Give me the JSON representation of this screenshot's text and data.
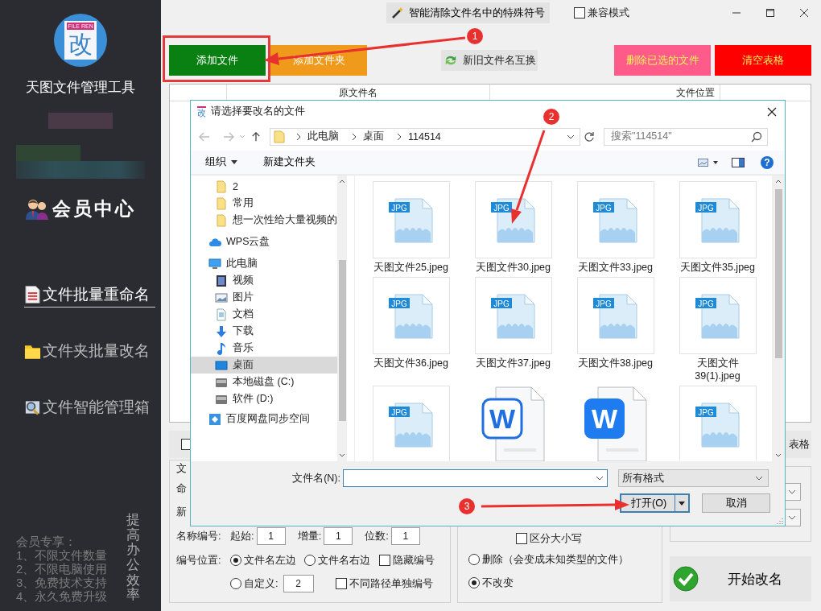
{
  "sidebar": {
    "logo": {
      "tag": "FILE REN",
      "glyph": "改"
    },
    "app_name": "天图文件管理工具",
    "member_center": "会员中心",
    "nav": [
      {
        "label": "文件批量重命名",
        "kind": "list",
        "selected": true
      },
      {
        "label": "文件夹批量改名",
        "kind": "folder",
        "selected": false
      },
      {
        "label": "文件智能管理箱",
        "kind": "search",
        "selected": false
      }
    ],
    "perks": [
      "会员专享：",
      "1、不限文件数量",
      "2、不限电脑使用",
      "3、免费技术支持",
      "4、永久免费升级"
    ],
    "slogan": "提高办公效率"
  },
  "top_bar": {
    "clean_button": "智能清除文件名中的特殊符号",
    "compat": {
      "label": "兼容模式",
      "checked": false
    }
  },
  "toolbar": [
    {
      "label": "添加文件",
      "kind": "green",
      "highlighted": true
    },
    {
      "label": "添加文件夹",
      "kind": "orange",
      "highlighted": false
    },
    {
      "label": "新旧文件名互换",
      "kind": "swap",
      "highlighted": false
    },
    {
      "label": "删除已选的文件",
      "kind": "pink",
      "highlighted": false
    },
    {
      "label": "清空表格",
      "kind": "red",
      "highlighted": false
    }
  ],
  "table": {
    "columns": [
      "原文件名",
      "文件位置"
    ]
  },
  "table_footer": {
    "select_all_checked": false,
    "right_label": "表格"
  },
  "rename_group": {
    "title": "文",
    "rows": [
      "命",
      "新"
    ],
    "numbering": {
      "label": "名称编号:",
      "fields": [
        {
          "label": "起始:",
          "value": "1"
        },
        {
          "label": "增量:",
          "value": "1"
        },
        {
          "label": "位数:",
          "value": "1"
        }
      ]
    },
    "position": {
      "label": "编号位置:",
      "left": {
        "label": "文件名左边",
        "selected": true
      },
      "right": {
        "label": "文件名右边",
        "selected": false
      },
      "custom": {
        "label": "自定义:",
        "selected": false,
        "value": "2"
      },
      "hide": {
        "label": "隐藏编号",
        "checked": false
      },
      "separate": {
        "label": "不同路径单独编号",
        "checked": false
      }
    }
  },
  "extension_group": {
    "case": {
      "label": "区分大小写",
      "checked": false
    },
    "options": [
      {
        "label": "删除（会变成未知类型的文件）",
        "selected": false
      },
      {
        "label": "不改变",
        "selected": true
      }
    ]
  },
  "start_button": "开始改名",
  "dialog": {
    "icon_glyph": "改",
    "title": "请选择要改名的文件",
    "path": [
      "此电脑",
      "桌面",
      "114514"
    ],
    "search_placeholder": "搜索\"114514\"",
    "organize": "组织",
    "new_folder": "新建文件夹",
    "help": "?",
    "tree": [
      {
        "label": "2",
        "kind": "folder",
        "selected": false
      },
      {
        "label": "常用",
        "kind": "folder",
        "selected": false
      },
      {
        "label": "想一次性给大量视频的",
        "kind": "folder",
        "selected": false
      },
      {
        "label": "WPS云盘",
        "kind": "cloud",
        "selected": false
      },
      {
        "label": "此电脑",
        "kind": "computer",
        "selected": false,
        "children": [
          {
            "label": "视频",
            "kind": "video",
            "selected": false
          },
          {
            "label": "图片",
            "kind": "picture",
            "selected": false
          },
          {
            "label": "文档",
            "kind": "document",
            "selected": false
          },
          {
            "label": "下载",
            "kind": "download",
            "selected": false
          },
          {
            "label": "音乐",
            "kind": "music",
            "selected": false
          },
          {
            "label": "桌面",
            "kind": "desktop",
            "selected": true
          },
          {
            "label": "本地磁盘 (C:)",
            "kind": "drive",
            "selected": false
          },
          {
            "label": "软件 (D:)",
            "kind": "drive",
            "selected": false
          }
        ]
      },
      {
        "label": "百度网盘同步空间",
        "kind": "sync",
        "selected": false
      }
    ],
    "files": [
      {
        "name": "天图文件25.jpeg",
        "kind": "jpg",
        "tag": "JPG"
      },
      {
        "name": "天图文件30.jpeg",
        "kind": "jpg",
        "tag": "JPG"
      },
      {
        "name": "天图文件33.jpeg",
        "kind": "jpg",
        "tag": "JPG"
      },
      {
        "name": "天图文件35.jpeg",
        "kind": "jpg",
        "tag": "JPG"
      },
      {
        "name": "天图文件36.jpeg",
        "kind": "jpg",
        "tag": "JPG"
      },
      {
        "name": "天图文件37.jpeg",
        "kind": "jpg",
        "tag": "JPG"
      },
      {
        "name": "天图文件38.jpeg",
        "kind": "jpg",
        "tag": "JPG"
      },
      {
        "name": "天图文件39(1).jpeg",
        "kind": "jpg",
        "tag": "JPG"
      },
      {
        "kind": "jpg",
        "tag": "JPG"
      },
      {
        "kind": "wps-outline",
        "tag": "W"
      },
      {
        "kind": "wps-filled",
        "tag": "W"
      },
      {
        "kind": "jpg",
        "tag": "JPG"
      }
    ],
    "filename_label": "文件名(N):",
    "filetype": "所有格式",
    "open": "打开(O)",
    "cancel": "取消"
  },
  "annotations": [
    "1",
    "2",
    "3"
  ]
}
